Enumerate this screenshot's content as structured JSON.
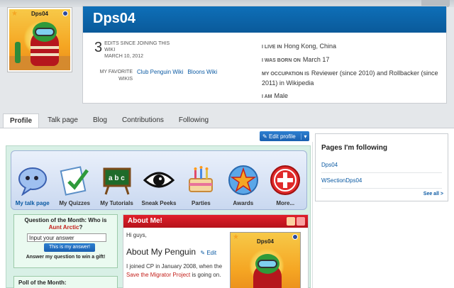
{
  "avatar": {
    "name": "Dps04"
  },
  "header": {
    "username": "Dps04",
    "edit_count": "3",
    "edits_label": "EDITS SINCE JOINING THIS WIKI",
    "join_date": "MARCH 10, 2012",
    "favorite_label": "MY FAVORITE WIKIS",
    "favorite_wikis": [
      "Club Penguin Wiki",
      "Bloons Wiki"
    ],
    "info": {
      "live_label": "I LIVE IN",
      "live_value": "Hong Kong, China",
      "born_label": "I WAS BORN ON",
      "born_value": "March 17",
      "occupation_label": "MY OCCUPATION IS",
      "occupation_value": "Reviewer (since 2010) and Rollbacker (since 2011) in Wikipedia",
      "gender_label": "I AM",
      "gender_value": "Male"
    }
  },
  "tabs": [
    "Profile",
    "Talk page",
    "Blog",
    "Contributions",
    "Following"
  ],
  "edit_profile_label": "Edit profile",
  "icon_bar": [
    {
      "label": "My talk page",
      "icon": "speech-bubble-icon"
    },
    {
      "label": "My Quizzes",
      "icon": "checklist-icon"
    },
    {
      "label": "My Tutorials",
      "icon": "chalkboard-icon"
    },
    {
      "label": "Sneak Peeks",
      "icon": "eye-icon"
    },
    {
      "label": "Parties",
      "icon": "cake-icon"
    },
    {
      "label": "Awards",
      "icon": "star-award-icon"
    },
    {
      "label": "More...",
      "icon": "plus-circle-icon"
    }
  ],
  "question": {
    "title": "Question of the Month: Who is",
    "name": "Aunt Arctic",
    "qmark": "?",
    "input_value": "Input your answer",
    "button": "This is my answer!",
    "note": "Answer my question to win a gift!"
  },
  "poll_title": "Poll of the Month:",
  "about": {
    "title": "About Me!",
    "greeting": "Hi guys,",
    "heading": "About My Penguin",
    "edit_link": "Edit",
    "text_1": "I joined CP in January 2008, when the",
    "link_text": "Save the Migrator Project",
    "text_2": "is going on.",
    "mini_avatar_name": "Dps04"
  },
  "rail": {
    "title": "Pages I'm following",
    "items": [
      "Dps04",
      "WSectionDps04"
    ],
    "see_all": "See all >"
  }
}
